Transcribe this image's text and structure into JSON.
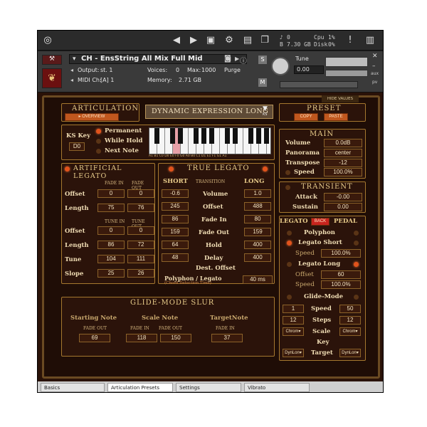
{
  "toolbar": {
    "logo": "kontakt-logo",
    "voices_count": "0",
    "memory": "7.30 GB",
    "cpu_label": "Cpu",
    "cpu_value": "1%",
    "disk_label": "Disk",
    "disk_value": "0%"
  },
  "instrument": {
    "name": "CH - EnsString All Mix Full Mid",
    "output_label": "Output:",
    "output_value": "st. 1",
    "midi_label": "MIDI Ch:",
    "midi_value": "[A] 1",
    "voices_label": "Voices:",
    "voices_value": "0",
    "max_label": "Max:",
    "max_value": "1000",
    "purge_label": "Purge",
    "memory_label": "Memory:",
    "memory_value": "2.71 GB",
    "tune_label": "Tune",
    "tune_value": "0.00",
    "s_label": "S",
    "m_label": "M",
    "hide_values": "HIDE VALUES",
    "aux": "aux",
    "pv": "pv"
  },
  "articulation": {
    "title": "ARTICULATION",
    "overview": "OVERVIEW",
    "selected": "DYNAMIC EXPRESSION LONG",
    "ks": "KS"
  },
  "preset": {
    "title": "PRESET",
    "copy": "COPY",
    "paste": "PASTE"
  },
  "ks": {
    "label": "KS Key",
    "key": "D0",
    "permanent": "Permanent",
    "while_hold": "While Hold",
    "next_note": "Next Note",
    "key_labels": "A1 B1 C0 D0 E0 F0 G0 A0 B0 C1 D1 E1 F1 G1 A1"
  },
  "main": {
    "title": "MAIN",
    "volume_label": "Volume",
    "volume": "0.0dB",
    "pan_label": "Panorama",
    "pan": "center",
    "transpose_label": "Transpose",
    "transpose": "-12",
    "speed_label": "Speed",
    "speed": "100.0%"
  },
  "transient": {
    "title": "TRANSIENT",
    "attack_label": "Attack",
    "attack": "-0.00",
    "sustain_label": "Sustain",
    "sustain": "0.00"
  },
  "artificial": {
    "title": "ARTIFICIAL LEGATO",
    "fade_in": "FADE IN",
    "fade_out": "FADE OUT",
    "tune_in": "TUNE IN",
    "tune_out": "TUNE OUT",
    "offset_label": "Offset",
    "length_label": "Length",
    "tune_label": "Tune",
    "slope_label": "Slope",
    "offset1": "0",
    "offset2": "0",
    "length1": "75",
    "length2": "76",
    "offset3": "0",
    "offset4": "0",
    "length3": "86",
    "length4": "72",
    "tune1": "104",
    "tune2": "111",
    "slope1": "25",
    "slope2": "26"
  },
  "true_legato": {
    "title": "TRUE LEGATO",
    "short": "SHORT",
    "transition": "TRANSITION",
    "long": "LONG",
    "volume_label": "Volume",
    "offset_label": "Offset",
    "fadein_label": "Fade In",
    "fadeout_label": "Fade Out",
    "hold_label": "Hold",
    "delay_label": "Delay",
    "dest_label": "Dest. Offset",
    "vol_s": "-0.6",
    "vol_l": "1.0",
    "off_s": "245",
    "off_l": "488",
    "fi_s": "86",
    "fi_l": "80",
    "fo_s": "159",
    "fo_l": "159",
    "hold_s": "64",
    "hold_l": "400",
    "delay_s": "48",
    "delay_l": "400",
    "poly_label": "Polyphon / Legato",
    "poly_sub": "(Chord Detection Time)",
    "poly_value": "40 ms"
  },
  "legato_pedal": {
    "legato": "LEGATO",
    "back": "BACK",
    "pedal": "PEDAL",
    "polyphon": "Polyphon",
    "legato_short": "Legato Short",
    "speed_label": "Speed",
    "speed1": "100.0%",
    "legato_long": "Legato Long",
    "offset_label": "Offset",
    "offset": "60",
    "speed2": "100.0%",
    "glide_mode": "Glide-Mode",
    "g1": "1",
    "speed3_label": "Speed",
    "speed3": "50",
    "g2": "12",
    "steps_label": "Steps",
    "steps": "12",
    "chrom1": "Chrom",
    "scale_label": "Scale",
    "chrom2": "Chrom",
    "key_label": "Key",
    "target_label": "Target",
    "dyn1": "DynLon",
    "dyn2": "DynLon"
  },
  "glide_slur": {
    "title": "GLIDE-MODE SLUR",
    "starting": "Starting Note",
    "scale": "Scale Note",
    "target": "TargetNote",
    "fade_out": "FADE OUT",
    "fade_in": "FADE IN",
    "start_fo": "69",
    "scale_fi": "118",
    "scale_fo": "150",
    "target_fi": "37"
  },
  "tabs": [
    "Basics",
    "Articulation Presets",
    "Settings",
    "Vibrato"
  ]
}
